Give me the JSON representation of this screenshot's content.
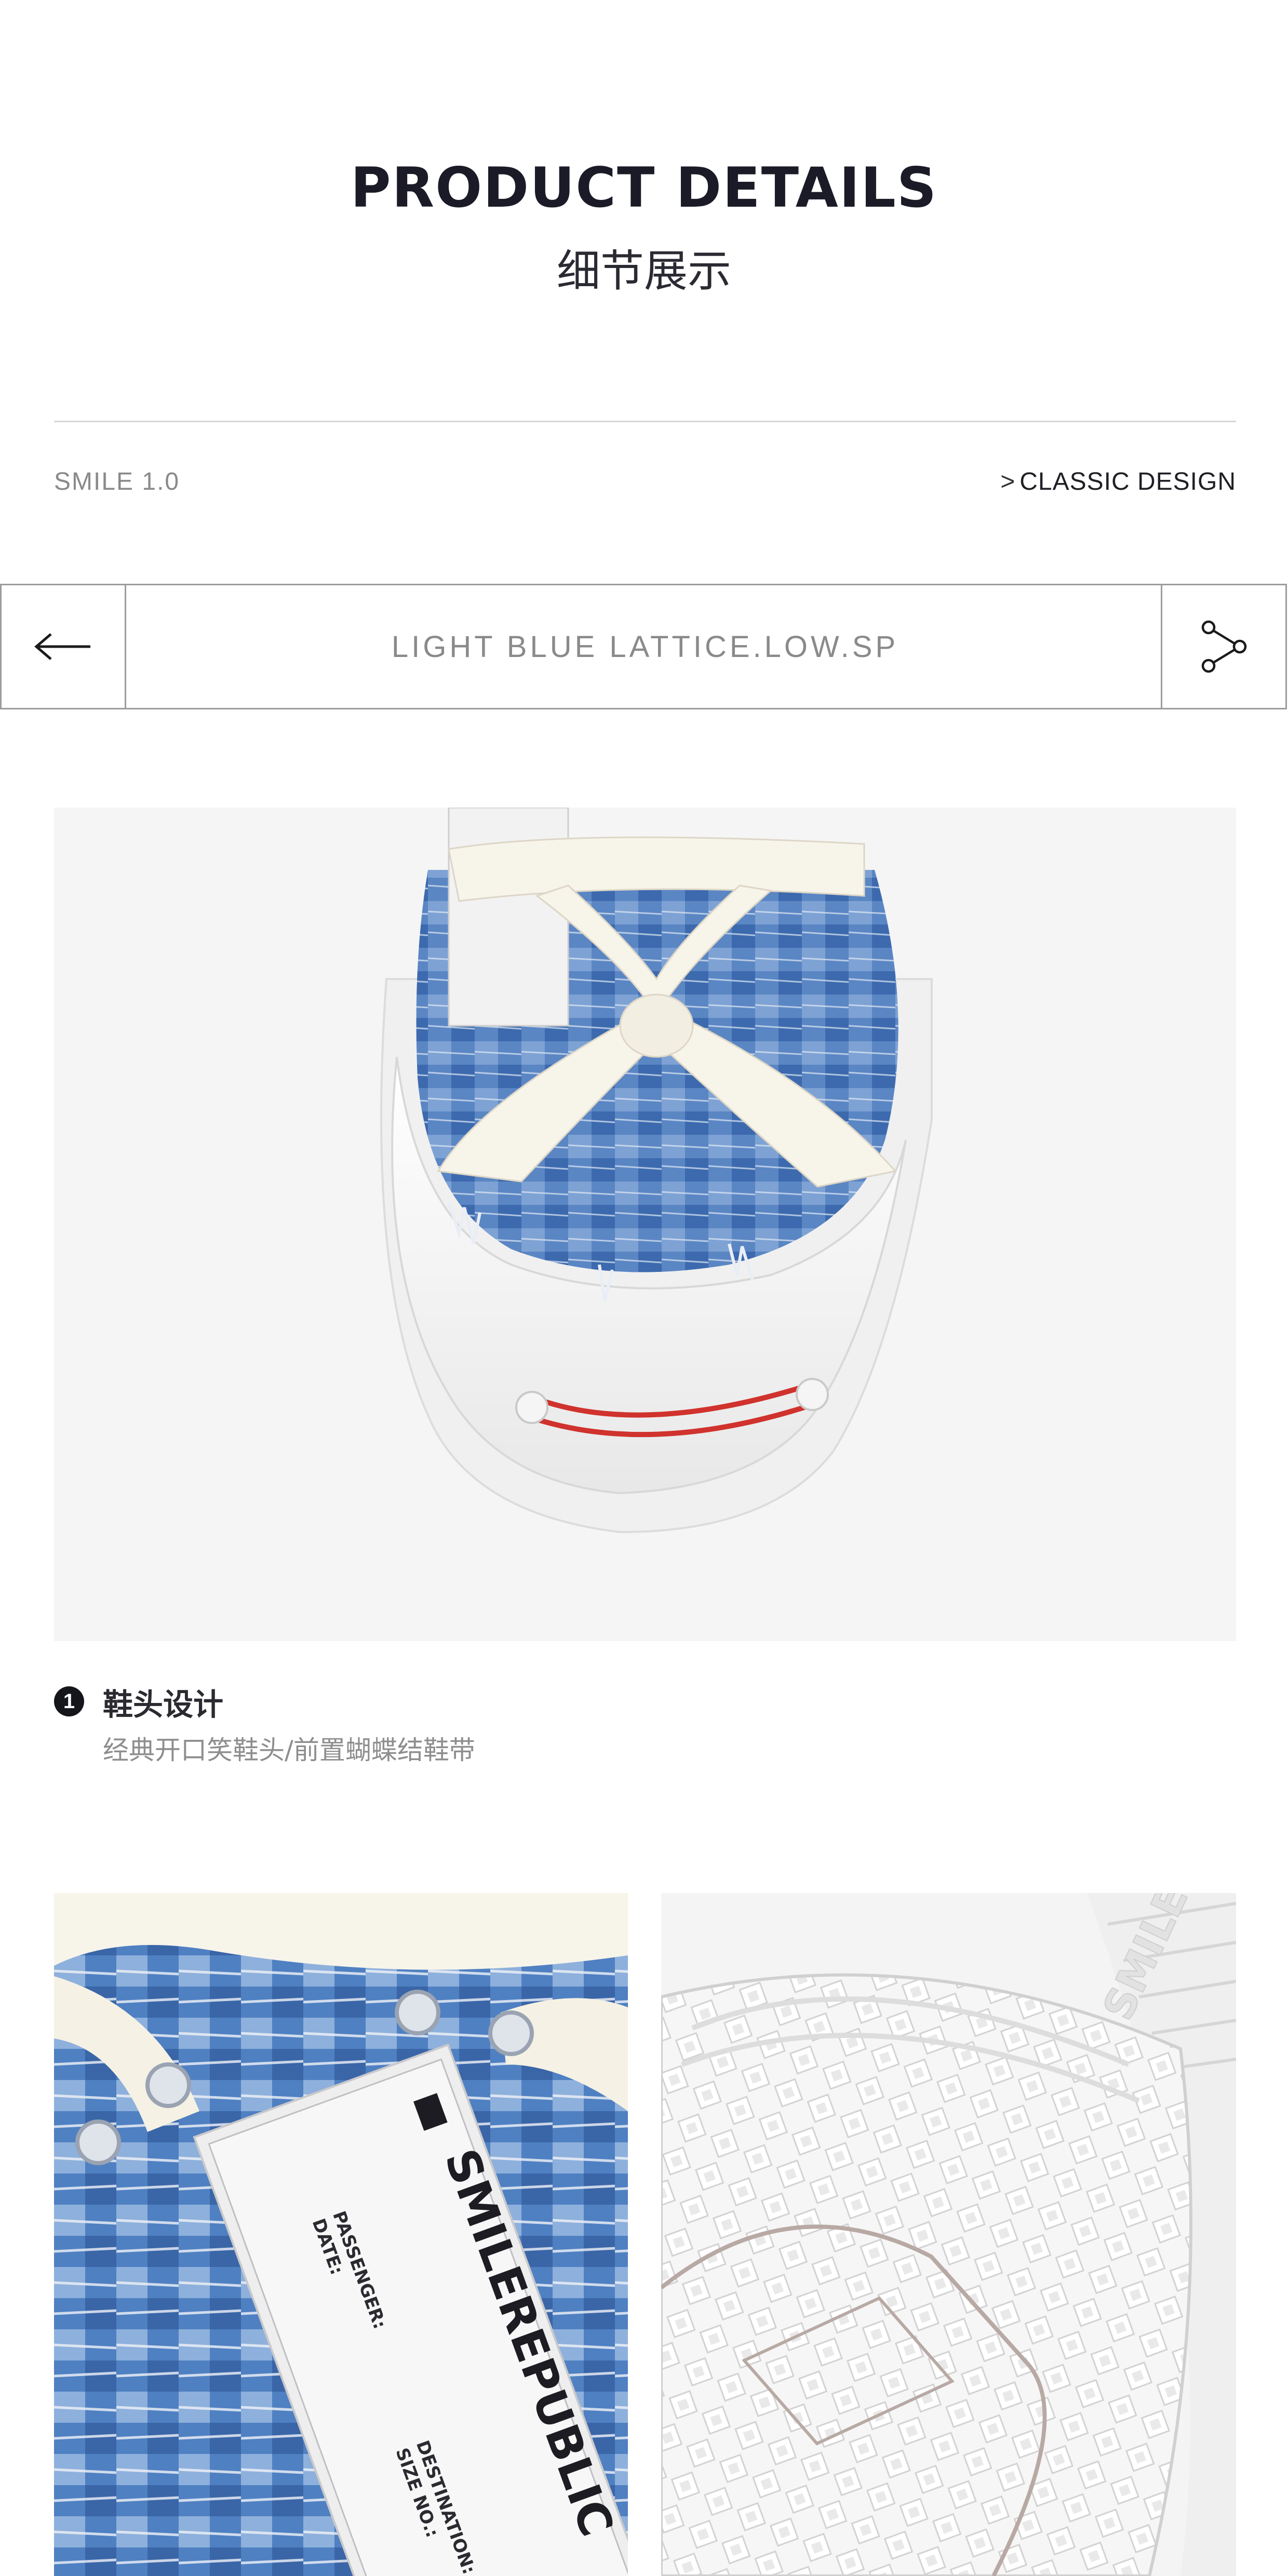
{
  "header": {
    "title": "PRODUCT DETAILS",
    "subtitle": "细节展示"
  },
  "meta_row": {
    "series": "SMILE 1.0",
    "collection_chevron": ">",
    "collection": "CLASSIC DESIGN"
  },
  "navbar": {
    "back_icon": "arrow-left-icon",
    "title": "LIGHT BLUE LATTICE.LOW.SP",
    "share_icon": "share-icon"
  },
  "main_image": {
    "subject": "shoe-toe-cap"
  },
  "caption": {
    "number": "1",
    "title": "鞋头设计",
    "description": "经典开口笑鞋头/前置蝴蝶结鞋带"
  },
  "tag_image": {
    "brand_text": "SMILEREPUBLIC",
    "field_passenger": "PASSENGER:",
    "field_date": "DATE:",
    "field_destination": "DESTINATION:",
    "field_size": "SIZE NO.:"
  },
  "sole_image": {
    "sole_text": "SMILERE"
  },
  "colors": {
    "dark_text": "#1b1b28",
    "muted_text": "#8a8a8a",
    "denim_blue": "#4a7bbf",
    "smile_red": "#d0322d",
    "photo_bg": "#f5f5f5"
  }
}
